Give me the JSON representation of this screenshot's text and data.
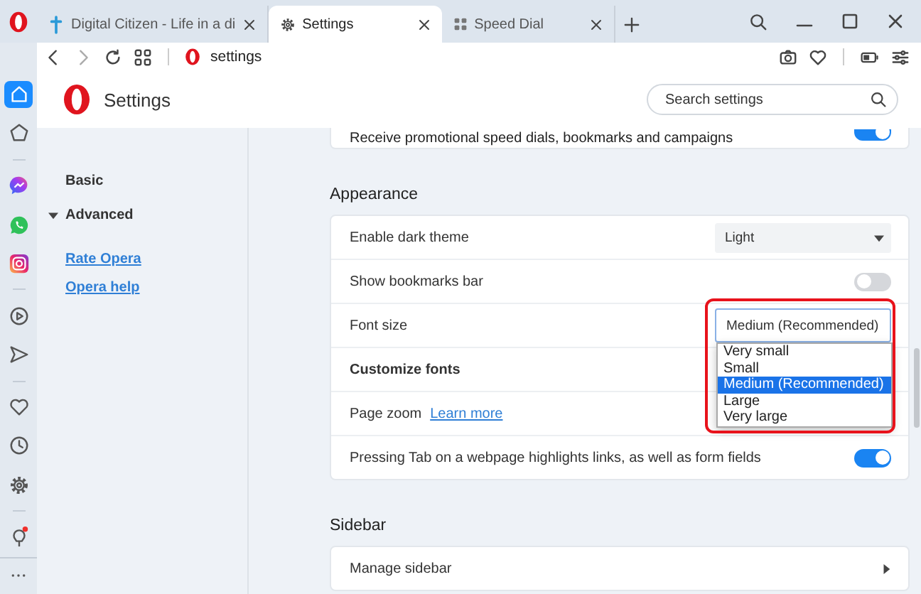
{
  "tabs": [
    {
      "kind": "site",
      "title": "Digital Citizen - Life in a di",
      "selected": false
    },
    {
      "kind": "settings",
      "title": "Settings",
      "selected": true
    },
    {
      "kind": "speed-dial",
      "title": "Speed Dial",
      "selected": false
    }
  ],
  "address_bar": {
    "url": "settings"
  },
  "sidebar": {
    "groups": [
      {
        "items": [
          {
            "kind": "home",
            "selected": true
          },
          {
            "kind": "pinboard",
            "selected": false
          }
        ]
      },
      {
        "items": [
          {
            "kind": "chat-bubble",
            "selected": false
          },
          {
            "kind": "phone-bubble",
            "selected": false
          },
          {
            "kind": "camera-square",
            "selected": false
          }
        ]
      },
      {
        "items": [
          {
            "kind": "player",
            "selected": false
          },
          {
            "kind": "send",
            "selected": false
          }
        ]
      },
      {
        "items": [
          {
            "kind": "heart",
            "selected": false
          },
          {
            "kind": "clock",
            "selected": false
          },
          {
            "kind": "gear",
            "selected": false
          }
        ]
      },
      {
        "items": [
          {
            "kind": "bulb",
            "selected": false
          }
        ]
      }
    ]
  },
  "settings": {
    "title": "Settings",
    "search": {
      "placeholder": "Search settings"
    },
    "nav": {
      "items": [
        {
          "kind": "item",
          "label": "Basic"
        },
        {
          "kind": "group",
          "label": "Advanced",
          "expanded": true
        }
      ],
      "links": [
        {
          "label": "Rate Opera"
        },
        {
          "label": "Opera help"
        }
      ]
    },
    "top_row": {
      "label": "Receive promotional speed dials, bookmarks and campaigns",
      "on": true
    },
    "sections": [
      {
        "title": "Appearance",
        "rows": [
          {
            "kind": "select",
            "label": "Enable dark theme",
            "value": "Light",
            "expanded": false
          },
          {
            "kind": "toggle",
            "label": "Show bookmarks bar",
            "on": false
          },
          {
            "kind": "select",
            "label": "Font size",
            "value": "Medium (Recommended)",
            "expanded": true,
            "options": [
              {
                "label": "Very small",
                "selected": false
              },
              {
                "label": "Small",
                "selected": false
              },
              {
                "label": "Medium (Recommended)",
                "selected": true
              },
              {
                "label": "Large",
                "selected": false
              },
              {
                "label": "Very large",
                "selected": false
              }
            ]
          },
          {
            "kind": "emphasis",
            "label": "Customize fonts"
          },
          {
            "kind": "link",
            "label": "Page zoom",
            "link": "Learn more"
          },
          {
            "kind": "toggle",
            "label": "Pressing Tab on a webpage highlights links, as well as form fields",
            "on": true
          }
        ]
      },
      {
        "title": "Sidebar",
        "rows": [
          {
            "kind": "subpage",
            "label": "Manage sidebar"
          }
        ]
      }
    ]
  }
}
